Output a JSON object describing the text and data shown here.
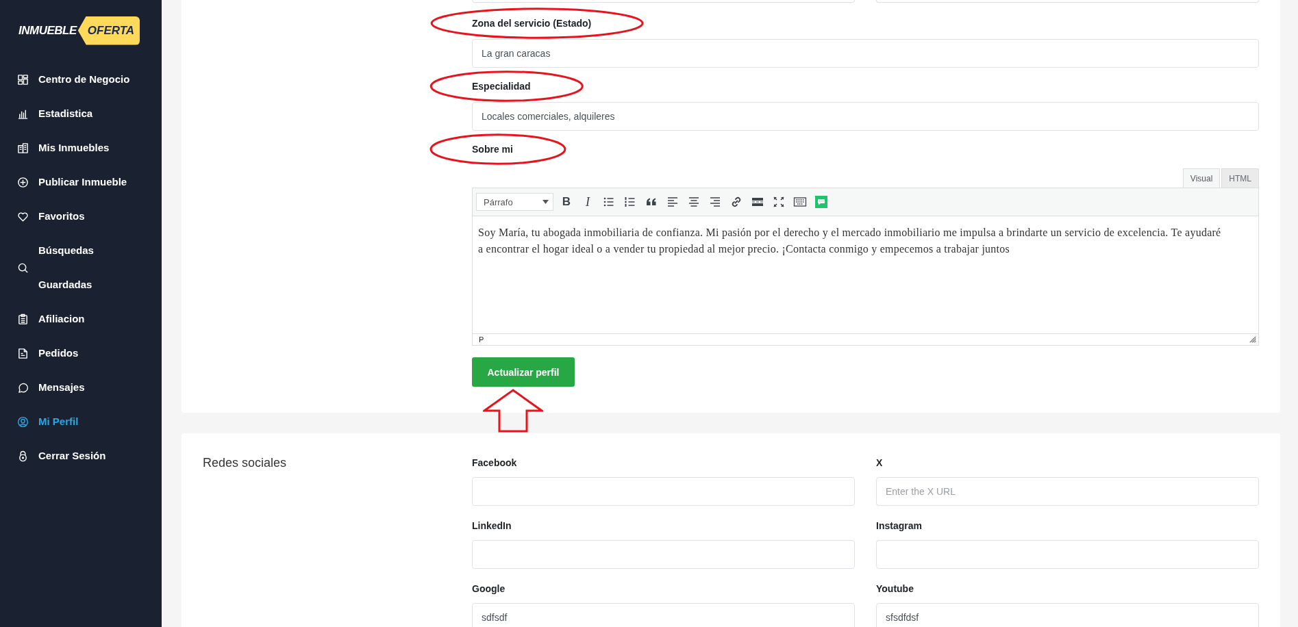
{
  "logo": {
    "word": "INMUEBLE",
    "tag": "OFERTA"
  },
  "sidebar": {
    "items": [
      {
        "label": "Centro de Negocio",
        "kind": "dashboard",
        "selected": false
      },
      {
        "label": "Estadistica",
        "kind": "chart",
        "selected": false
      },
      {
        "label": "Mis Inmuebles",
        "kind": "building",
        "selected": false
      },
      {
        "label": "Publicar Inmueble",
        "kind": "plus",
        "selected": false
      },
      {
        "label": "Favoritos",
        "kind": "heart",
        "selected": false
      },
      {
        "label": "Búsquedas\nGuardadas",
        "kind": "search",
        "selected": false
      },
      {
        "label": "Afiliacion",
        "kind": "clipboard",
        "selected": false
      },
      {
        "label": "Pedidos",
        "kind": "document",
        "selected": false
      },
      {
        "label": "Mensajes",
        "kind": "chat",
        "selected": false
      },
      {
        "label": "Mi Perfil",
        "kind": "user",
        "selected": true
      },
      {
        "label": "Cerrar Sesión",
        "kind": "lock",
        "selected": false
      }
    ]
  },
  "profile": {
    "partial_fields": [
      {
        "kind": "text"
      },
      {
        "kind": "text"
      }
    ],
    "fields": [
      {
        "label": "Zona del servicio (Estado)",
        "value": "La gran caracas",
        "circled": true
      },
      {
        "label": "Especialidad",
        "value": "Locales comerciales, alquileres",
        "circled": true
      }
    ],
    "about": {
      "label": "Sobre mi",
      "circled": true,
      "editor": {
        "tabs": [
          {
            "label": "Visual",
            "selected": true
          },
          {
            "label": "HTML",
            "selected": false
          }
        ],
        "format": "Párrafo",
        "toolbar": [
          {
            "kind": "bold",
            "glyph": "B"
          },
          {
            "kind": "italic",
            "glyph": "I"
          },
          {
            "kind": "bullet-list"
          },
          {
            "kind": "numbered-list"
          },
          {
            "kind": "blockquote"
          },
          {
            "kind": "align-left"
          },
          {
            "kind": "align-center"
          },
          {
            "kind": "align-right"
          },
          {
            "kind": "link"
          },
          {
            "kind": "read-more"
          },
          {
            "kind": "fullscreen"
          },
          {
            "kind": "keyboard"
          },
          {
            "kind": "plugin"
          }
        ],
        "content": "Soy María, tu abogada inmobiliaria de confianza. Mi pasión por el derecho y el mercado inmobiliario me impulsa a brindarte un servicio de excelencia. Te ayudaré a encontrar el hogar ideal o a vender tu propiedad al mejor precio. ¡Contacta conmigo y empecemos a trabajar juntos",
        "path": "P"
      }
    },
    "submit": {
      "label": "Actualizar perfil",
      "arrow_annotation": true
    }
  },
  "social": {
    "title": "Redes sociales",
    "fields": [
      {
        "label": "Facebook"
      },
      {
        "label": "X",
        "placeholder": "Enter the X URL"
      },
      {
        "label": "LinkedIn"
      },
      {
        "label": "Instagram"
      },
      {
        "label": "Google",
        "value": "sdfsdf"
      },
      {
        "label": "Youtube",
        "value": "sfsdfdsf"
      }
    ]
  }
}
